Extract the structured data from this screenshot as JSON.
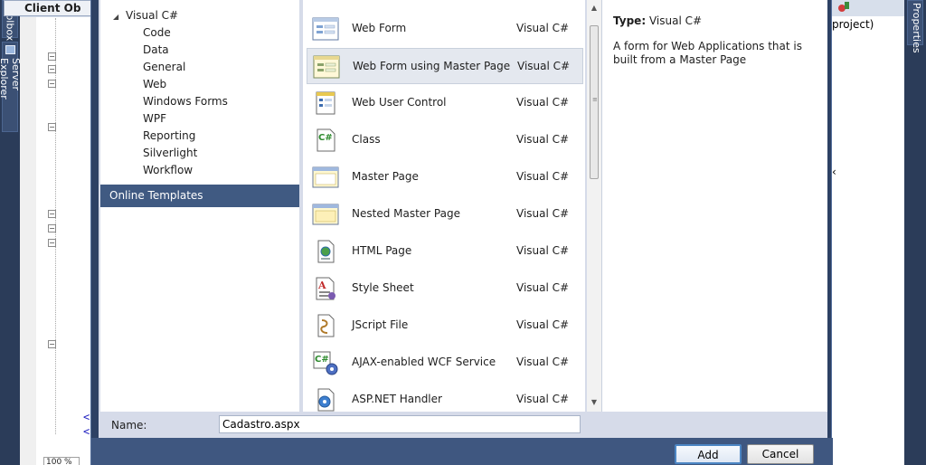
{
  "ide": {
    "left_tabs": [
      "Toolbox",
      "Server Explorer"
    ],
    "editor_tab": "Client Objects & Events",
    "editor_tab_visible": "Client Ob",
    "zoom": "100 %",
    "right_text": "project)",
    "right_tab": "Properties",
    "xml_marks": [
      "<",
      "<"
    ]
  },
  "dialog": {
    "tree": {
      "root": "Visual C#",
      "children": [
        "Code",
        "Data",
        "General",
        "Web",
        "Windows Forms",
        "WPF",
        "Reporting",
        "Silverlight",
        "Workflow"
      ],
      "online": "Online Templates"
    },
    "templates": [
      {
        "name": "Web Form",
        "lang": "Visual C#",
        "icon": "web-form-icon"
      },
      {
        "name": "Web Form using Master Page",
        "lang": "Visual C#",
        "icon": "web-form-master-icon"
      },
      {
        "name": "Web User Control",
        "lang": "Visual C#",
        "icon": "user-control-icon"
      },
      {
        "name": "Class",
        "lang": "Visual C#",
        "icon": "class-icon"
      },
      {
        "name": "Master Page",
        "lang": "Visual C#",
        "icon": "master-page-icon"
      },
      {
        "name": "Nested Master Page",
        "lang": "Visual C#",
        "icon": "nested-master-icon"
      },
      {
        "name": "HTML Page",
        "lang": "Visual C#",
        "icon": "html-page-icon"
      },
      {
        "name": "Style Sheet",
        "lang": "Visual C#",
        "icon": "style-sheet-icon"
      },
      {
        "name": "JScript File",
        "lang": "Visual C#",
        "icon": "jscript-icon"
      },
      {
        "name": "AJAX-enabled WCF Service",
        "lang": "Visual C#",
        "icon": "wcf-service-icon"
      },
      {
        "name": "ASP.NET Handler",
        "lang": "Visual C#",
        "icon": "handler-icon"
      }
    ],
    "selected_index": 1,
    "description": {
      "type_label": "Type:",
      "type_value": "Visual C#",
      "text": "A form for Web Applications that is built from a Master Page"
    },
    "name_label": "Name:",
    "name_value": "Cadastro.aspx",
    "add_label": "Add",
    "cancel_label": "Cancel"
  }
}
